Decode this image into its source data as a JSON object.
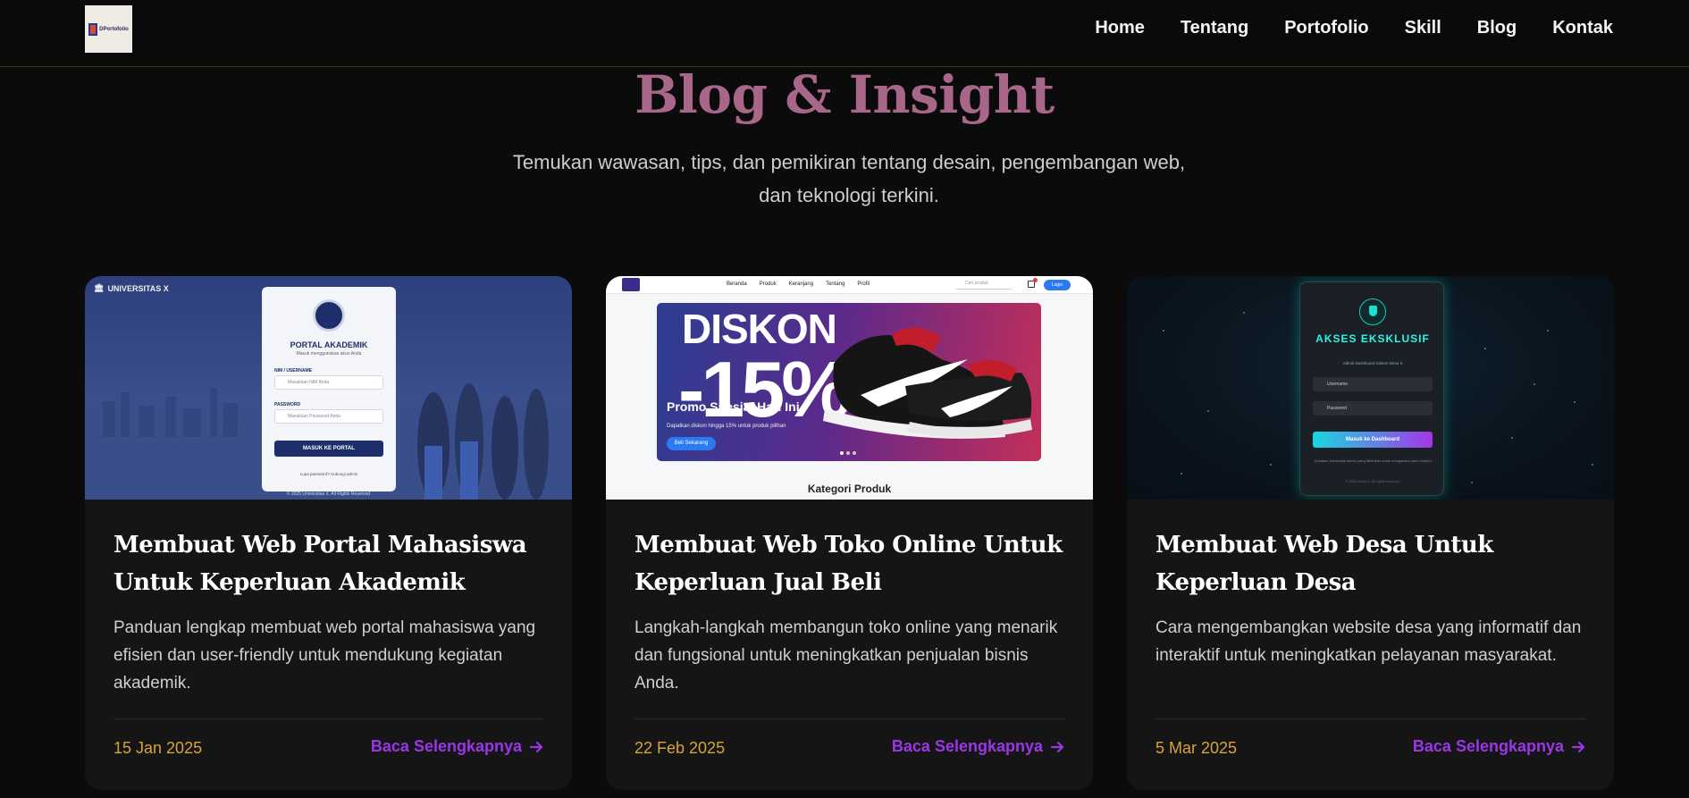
{
  "nav": {
    "logo_text": "DPortofolio",
    "items": [
      {
        "label": "Home"
      },
      {
        "label": "Tentang"
      },
      {
        "label": "Portofolio"
      },
      {
        "label": "Skill"
      },
      {
        "label": "Blog"
      },
      {
        "label": "Kontak"
      }
    ]
  },
  "hero": {
    "title": "Blog & Insight",
    "subtitle": "Temukan wawasan, tips, dan pemikiran tentang desain, pengembangan web, dan teknologi terkini."
  },
  "colors": {
    "heading": "#a86688",
    "date": "#d6a43a",
    "link": "#9b36e8",
    "card_bg": "#151515",
    "page_bg": "#0b0b0b"
  },
  "cards": [
    {
      "title": "Membuat Web Portal Mahasiswa Untuk Keperluan Akademik",
      "description": "Panduan lengkap membuat web portal mahasiswa yang efisien dan user-friendly untuk mendukung kegiatan akademik.",
      "date": "15 Jan 2025",
      "link_label": "Baca Selengkapnya",
      "thumb": {
        "university": "UNIVERSITAS X",
        "portal_title": "PORTAL AKADEMIK",
        "portal_subtitle": "Masuk menggunakan akun Anda",
        "label_nim": "NIM / USERNAME",
        "placeholder_nim": "Masukkan NIM Anda",
        "label_password": "PASSWORD",
        "placeholder_password": "Masukkan Password Anda",
        "button": "MASUK KE PORTAL",
        "footer_link": "Lupa password? Hubungi admin",
        "copyright": "© 2025 Universitas X. All Rights Reserved"
      }
    },
    {
      "title": "Membuat Web Toko Online Untuk Keperluan Jual Beli",
      "description": "Langkah-langkah membangun toko online yang menarik dan fungsional untuk meningkatkan penjualan bisnis Anda.",
      "date": "22 Feb 2025",
      "link_label": "Baca Selengkapnya",
      "thumb": {
        "nav": [
          "Beranda",
          "Produk",
          "Keranjang",
          "Tentang",
          "Profil"
        ],
        "search": "Cari produk",
        "login": "Login",
        "banner_line1": "DISKON",
        "banner_line2": "-15%",
        "promo": "Promo Spesial Hari Ini",
        "promo_desc": "Dapatkan diskon hingga 15% untuk produk pilihan",
        "buy": "Beli Sekarang",
        "category": "Kategori Produk"
      }
    },
    {
      "title": "Membuat Web Desa Untuk Keperluan Desa",
      "description": "Cara mengembangkan website desa yang informatif dan interaktif untuk meningkatkan pelayanan masyarakat.",
      "date": "5 Mar 2025",
      "link_label": "Baca Selengkapnya",
      "thumb": {
        "title": "AKSES EKSKLUSIF",
        "subtitle": "Admin Dashboard Sistem Desa X",
        "username": "Username",
        "password": "Password",
        "button": "Masuk ke Dashboard",
        "note": "Gunakan kredensial admin yang diberikan untuk mengakses panel kontrol",
        "footer": "© 2025 Desa X. All rights reserved"
      }
    }
  ]
}
